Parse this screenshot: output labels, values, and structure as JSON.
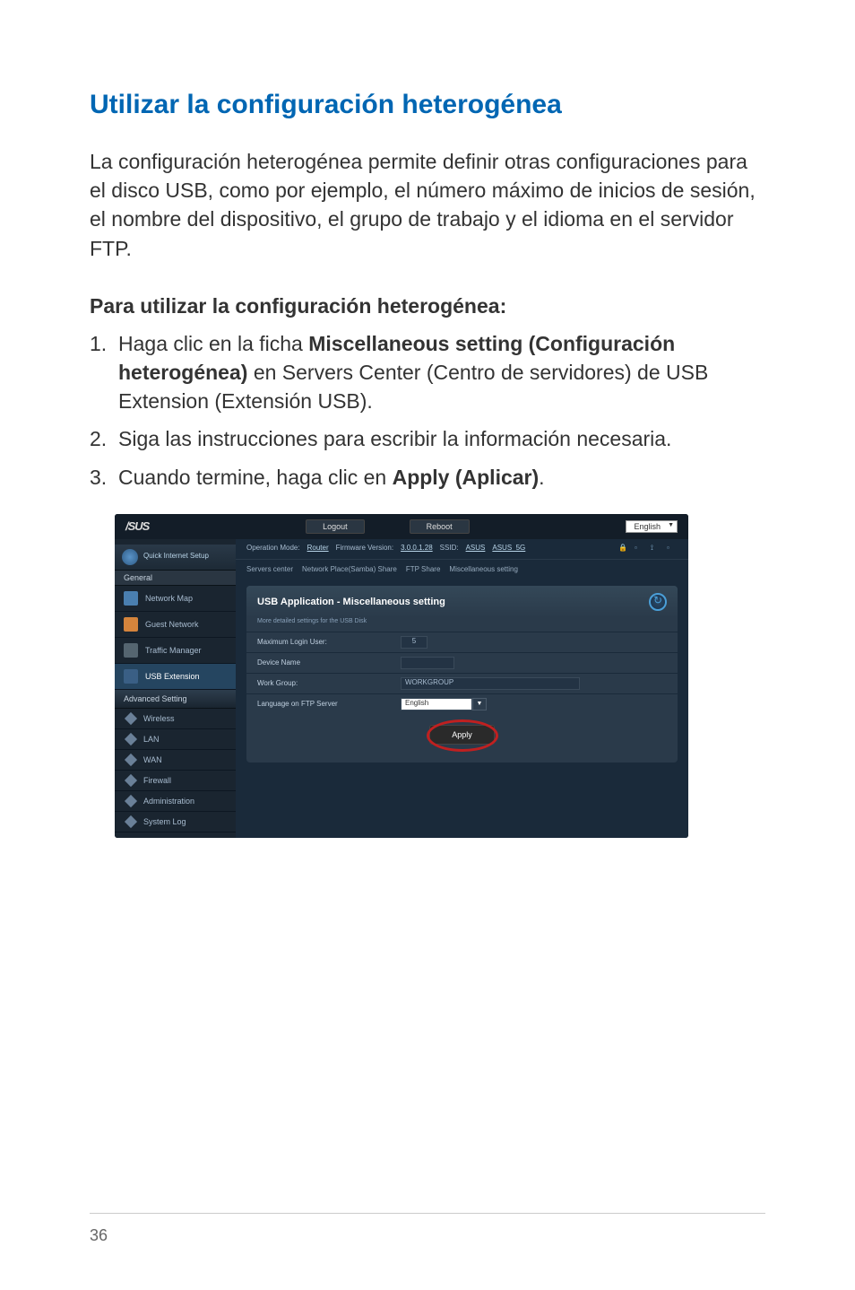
{
  "page": {
    "section_title": "Utilizar la configuración heterogénea",
    "intro": "La configuración heterogénea permite definir otras configuraciones para el disco USB, como por ejemplo, el número máximo de inicios de sesión, el nombre del dispositivo, el grupo de trabajo y el idioma en el servidor FTP.",
    "subsection": "Para utilizar la configuración heterogénea:",
    "steps": [
      {
        "pre": "Haga clic en la ficha ",
        "bold": "Miscellaneous setting (Configuración heterogénea)",
        "post": " en Servers Center (Centro de servidores) de USB Extension (Extensión USB)."
      },
      {
        "pre": "Siga las instrucciones para escribir la información necesaria.",
        "bold": "",
        "post": ""
      },
      {
        "pre": "Cuando termine, haga clic en ",
        "bold": "Apply (Aplicar)",
        "post": "."
      }
    ],
    "page_number": "36"
  },
  "screenshot": {
    "logo": "/SUS",
    "header": {
      "logout": "Logout",
      "reboot": "Reboot",
      "lang": "English"
    },
    "sidebar": {
      "quick": "Quick Internet Setup",
      "general": "General",
      "items_general": [
        "Network Map",
        "Guest Network",
        "Traffic Manager",
        "USB Extension"
      ],
      "advanced": "Advanced Setting",
      "items_advanced": [
        "Wireless",
        "LAN",
        "WAN",
        "Firewall",
        "Administration",
        "System Log"
      ]
    },
    "infobar": {
      "op_mode_label": "Operation Mode:",
      "op_mode_value": "Router",
      "fw_label": "Firmware Version:",
      "fw_value": "3.0.0.1.28",
      "ssid_label": "SSID:",
      "ssid_value": "ASUS",
      "ssid_5g": "ASUS_5G"
    },
    "tabs": [
      "Servers center",
      "Network Place(Samba) Share",
      "FTP Share",
      "Miscellaneous setting"
    ],
    "panel": {
      "title": "USB Application - Miscellaneous setting",
      "sub": "More detailed settings for the USB Disk",
      "rows": [
        {
          "label": "Maximum Login User:",
          "value": "5",
          "type": "select"
        },
        {
          "label": "Device Name",
          "value": "",
          "type": "text"
        },
        {
          "label": "Work Group:",
          "value": "WORKGROUP",
          "type": "text"
        },
        {
          "label": "Language on FTP Server",
          "value": "English",
          "type": "select-wide"
        }
      ],
      "apply": "Apply"
    }
  }
}
